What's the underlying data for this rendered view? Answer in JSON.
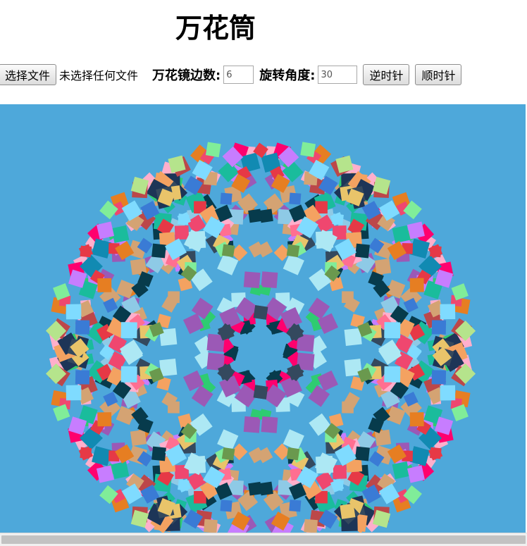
{
  "page": {
    "title": "万花筒"
  },
  "toolbar": {
    "file_button_label": "选择文件",
    "file_status": "未选择任何文件",
    "sides_label": "万花镜边数:",
    "sides_value": "6",
    "angle_label": "旋转角度:",
    "angle_value": "30",
    "ccw_button_label": "逆时针",
    "cw_button_label": "顺时针"
  },
  "canvas": {
    "background": "#4ea8da",
    "mirror_sides": 6,
    "tile_colors": [
      "#e63946",
      "#3a7bd5",
      "#2ecc71",
      "#f1c40f",
      "#9b59b6",
      "#1abc9c",
      "#e67e22",
      "#34495e",
      "#ff6f91",
      "#7fdbff",
      "#b5e48c",
      "#c77dff",
      "#f4a261",
      "#264653",
      "#ff006e",
      "#8ecae6",
      "#d4a373",
      "#06d6a0",
      "#ef476f",
      "#118ab2",
      "#ffd166",
      "#073b4c",
      "#a8dadc",
      "#e9c46a",
      "#6a994e",
      "#bc4749",
      "#ade8f4",
      "#ffafcc",
      "#1d3557",
      "#80ed99"
    ]
  }
}
